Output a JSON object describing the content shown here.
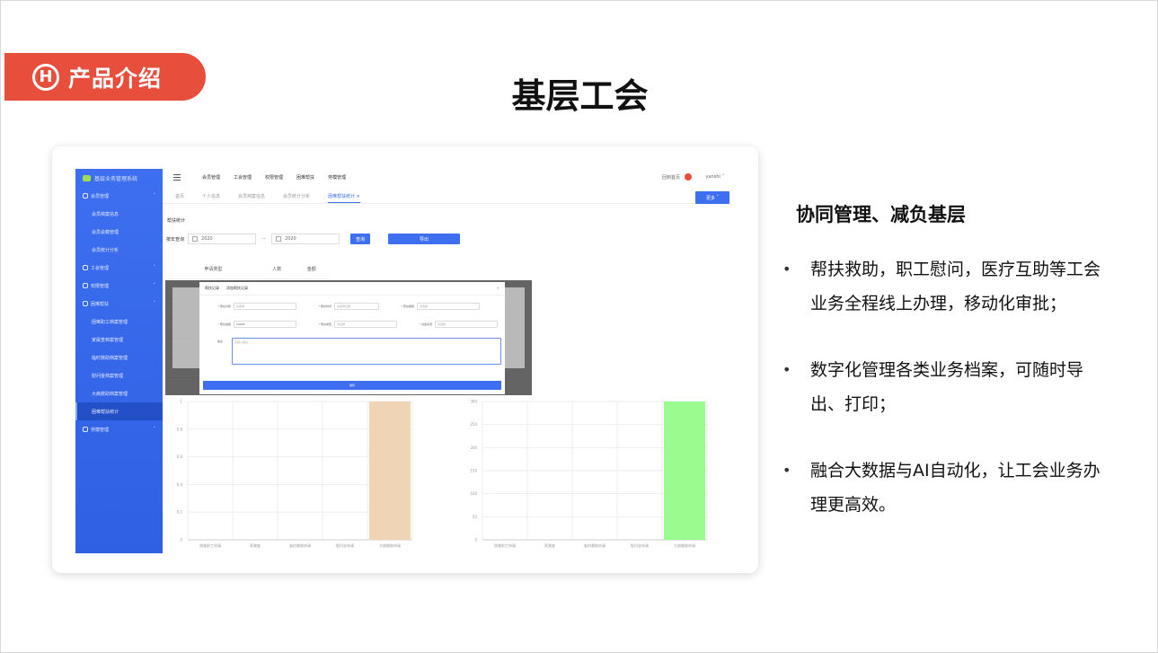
{
  "header": {
    "badge_label": "产品介绍",
    "badge_logo_letter": "H",
    "title": "基层工会"
  },
  "screenshot": {
    "sidebar": {
      "brand": "基层业务管理系统",
      "items": [
        {
          "label": "会员管理",
          "level": 0,
          "expanded": true
        },
        {
          "label": "会员档案信息",
          "level": 1
        },
        {
          "label": "会员会籍管理",
          "level": 1
        },
        {
          "label": "会员统计分析",
          "level": 1
        },
        {
          "label": "工会管理",
          "level": 0
        },
        {
          "label": "权限管理",
          "level": 0
        },
        {
          "label": "困难帮扶",
          "level": 0,
          "expanded": true
        },
        {
          "label": "困难职工档案管理",
          "level": 1
        },
        {
          "label": "家属查档案管理",
          "level": 1
        },
        {
          "label": "临时救助档案管理",
          "level": 1
        },
        {
          "label": "慰问金档案管理",
          "level": 1
        },
        {
          "label": "大病救助档案管理",
          "level": 1
        },
        {
          "label": "困难帮扶统计",
          "level": 1,
          "active": true
        },
        {
          "label": "劳模管理",
          "level": 0
        }
      ]
    },
    "topbar": {
      "menus": [
        "会员管理",
        "工会管理",
        "权限管理",
        "困难帮扶",
        "劳模管理"
      ],
      "home": "回到首页",
      "user": "yanshi"
    },
    "tabs": [
      "首页",
      "个人信息",
      "会员档案信息",
      "会员统计分析",
      "困难帮扶统计"
    ],
    "more_label": "更多",
    "section_title": "帮扶统计",
    "filter": {
      "label": "按年查询",
      "from": "2020",
      "to": "2020",
      "query_label": "查询",
      "export_label": "导出"
    },
    "stats_table": {
      "headers": [
        "申请类型",
        "人数",
        "金额"
      ],
      "rows": [
        [
          "困难职工申请",
          "0",
          ""
        ],
        [
          "家属查",
          "0",
          ""
        ],
        [
          "临时救助申请",
          "0",
          ""
        ],
        [
          "慰问金申请",
          "0",
          ""
        ],
        [
          "大病救助申请",
          "1",
          ""
        ]
      ]
    },
    "modal": {
      "tab_left": "帮扶记录",
      "title": "添加帮扶记录",
      "close": "×",
      "fields_row1": [
        {
          "label": "* 帮扶对象",
          "value": "请选择"
        },
        {
          "label": "* 帮扶时间",
          "value": "请选择日期"
        },
        {
          "label": "* 帮扶措施",
          "value": "请选择"
        }
      ],
      "fields_row2": [
        {
          "label": "* 帮扶金额",
          "value": "10000"
        },
        {
          "label": "* 帮扶类型",
          "value": "请选择"
        },
        {
          "label": "* 资金来源",
          "value": "请选择"
        }
      ],
      "remark_label": "备注",
      "remark_placeholder": "请输入备注",
      "save": "保存"
    }
  },
  "chart_data": [
    {
      "type": "bar",
      "categories": [
        "困难职工申请",
        "家属查",
        "临时救助申请",
        "慰问金申请",
        "大病救助申请"
      ],
      "values": [
        0,
        0,
        0,
        0,
        1
      ],
      "ylim": [
        0,
        1
      ],
      "yticks": [
        "0",
        "0.2",
        "0.4",
        "0.6",
        "0.8",
        "1"
      ],
      "color": "#efd5b5",
      "grid": true
    },
    {
      "type": "bar",
      "categories": [
        "困难职工申请",
        "家属查",
        "临时救助申请",
        "慰问金申请",
        "大病救助申请"
      ],
      "values": [
        0,
        0,
        0,
        0,
        300
      ],
      "ylim": [
        0,
        300
      ],
      "yticks": [
        "0",
        "50",
        "100",
        "150",
        "200",
        "250",
        "300"
      ],
      "color": "#9cfb8f",
      "grid": true
    }
  ],
  "right_panel": {
    "title": "协同管理、减负基层",
    "bullets": [
      "帮扶救助，职工慰问，医疗互助等工会业务全程线上办理，移动化审批；",
      "数字化管理各类业务档案，可随时导出、打印；",
      "融合大数据与AI自动化，让工会业务办理更高效。"
    ]
  }
}
